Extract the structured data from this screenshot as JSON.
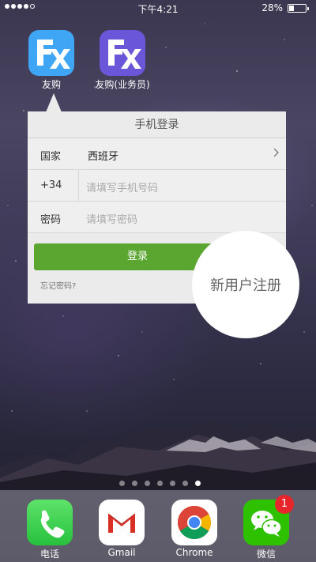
{
  "status_bar": {
    "time": "下午4:21",
    "battery": "28%",
    "signal_bars": 4
  },
  "apps": [
    {
      "name": "youguo-app",
      "label": "友购",
      "color": "#3ea6f5"
    },
    {
      "name": "youguo-business-app",
      "label": "友购(业务员)",
      "color": "#6a56d8"
    }
  ],
  "login_panel": {
    "title": "手机登录",
    "country_label": "国家",
    "country_value": "西班牙",
    "country_code": "+34",
    "phone_placeholder": "请填写手机号码",
    "password_label": "密码",
    "password_placeholder": "请填写密码",
    "login_button": "登录",
    "forgot_password": "忘记密码?"
  },
  "register_bubble": "新用户注册",
  "page_indicator": {
    "total": 7,
    "current": 7
  },
  "dock": [
    {
      "name": "phone-app",
      "label": "电话"
    },
    {
      "name": "gmail-app",
      "label": "Gmail"
    },
    {
      "name": "chrome-app",
      "label": "Chrome"
    },
    {
      "name": "wechat-app",
      "label": "微信",
      "badge": "1"
    }
  ]
}
